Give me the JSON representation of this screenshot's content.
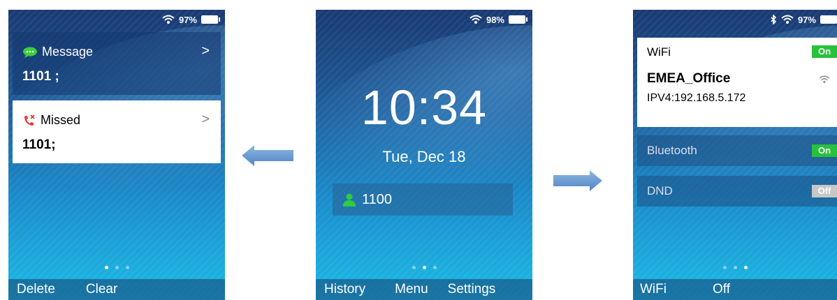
{
  "left": {
    "status": {
      "battery": "97%"
    },
    "message_card": {
      "title": "Message",
      "number": "1101 ;",
      "arrow": ">"
    },
    "missed_card": {
      "title": "Missed",
      "number": "1101;",
      "arrow": ">"
    },
    "page_dots": {
      "count": 3,
      "active": 1
    },
    "softkeys": {
      "left": "Delete",
      "middle": "Clear"
    }
  },
  "center": {
    "status": {
      "battery": "98%"
    },
    "time": "10:34",
    "date": "Tue, Dec 18",
    "extension": "1100",
    "page_dots": {
      "count": 3,
      "active": 2
    },
    "softkeys": {
      "left": "History",
      "middle": "Menu",
      "right": "Settings"
    }
  },
  "right": {
    "status": {
      "battery": "97%"
    },
    "wifi": {
      "label": "WiFi",
      "state": "On",
      "network": "EMEA_Office",
      "ip": "IPV4:192.168.5.172"
    },
    "bluetooth": {
      "label": "Bluetooth",
      "state": "On"
    },
    "dnd": {
      "label": "DND",
      "state": "Off"
    },
    "page_dots": {
      "count": 3,
      "active": 3
    },
    "softkeys": {
      "left": "WiFi",
      "middle": "Off"
    }
  },
  "icons": {
    "wifi": "wifi-icon",
    "battery": "battery-icon",
    "bluetooth": "bluetooth-icon",
    "message": "chat-bubble-icon",
    "missed": "missed-call-icon",
    "contact": "person-icon",
    "nav_left": "arrow-left-icon",
    "nav_right": "arrow-right-icon"
  },
  "colors": {
    "toggle_on": "#27c23a",
    "toggle_off": "#c7c7c7",
    "contact_icon": "#2ecc40",
    "missed_icon": "#e53935",
    "message_icon": "#3ccf3c"
  }
}
